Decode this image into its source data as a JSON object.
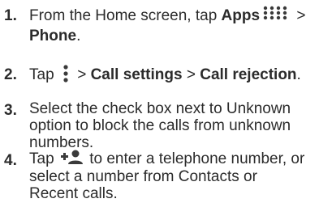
{
  "steps": [
    {
      "number": "1.",
      "line1_pre": "From the Home screen, tap ",
      "line1_bold": "Apps",
      "line1_post": " >",
      "line2_bold": "Phone",
      "line2_post": ".",
      "icon": "apps-grid-icon"
    },
    {
      "number": "2.",
      "pre": "Tap ",
      "mid": " > ",
      "bold1": "Call settings",
      "sep": " > ",
      "bold2": "Call rejection",
      "post": ".",
      "icon": "overflow-menu-icon"
    },
    {
      "number": "3.",
      "lines": [
        "Select the check box next to Unknown",
        "option to block the calls from unknown",
        "numbers."
      ]
    },
    {
      "number": "4.",
      "line1_pre": "Tap ",
      "line1_post": " to enter a telephone number, or",
      "lines": [
        "select a number from Contacts or",
        "Recent calls."
      ],
      "icon": "add-contact-icon"
    }
  ]
}
